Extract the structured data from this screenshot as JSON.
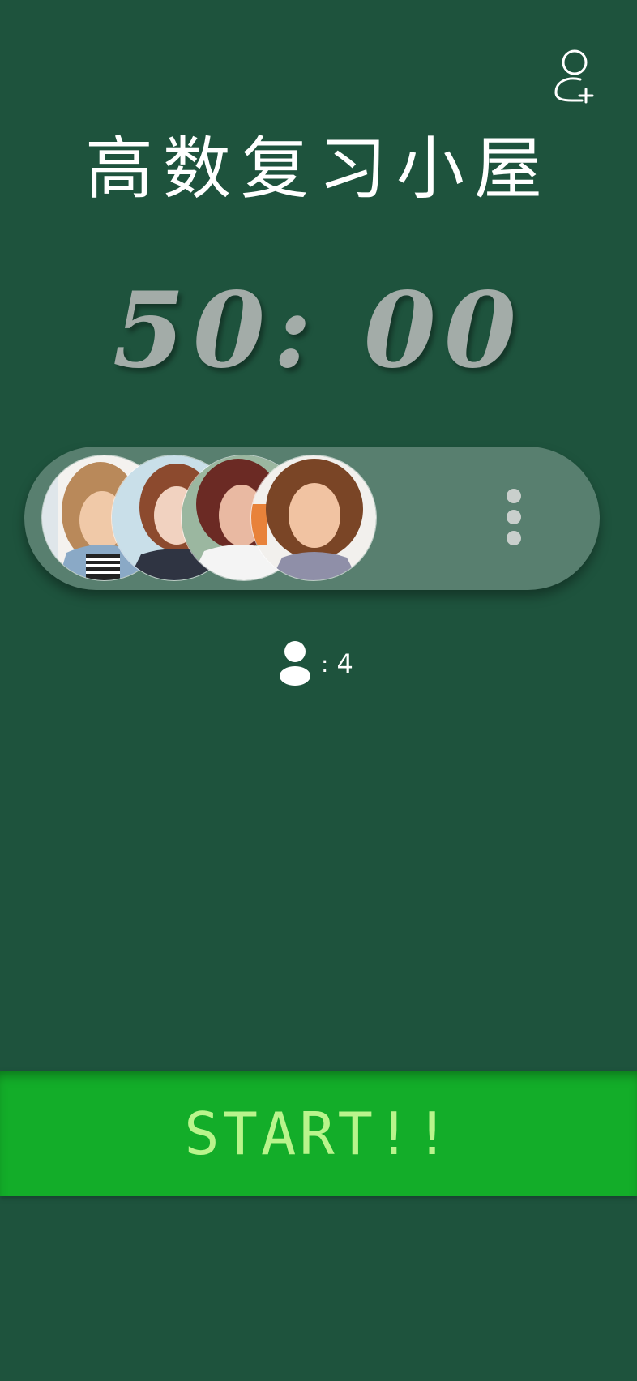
{
  "header": {
    "title": "高数复习小屋",
    "add_member_icon": "add-user-icon"
  },
  "timer": {
    "display": "50: 00"
  },
  "group": {
    "avatars": [
      {
        "icon": "avatar-photo"
      },
      {
        "icon": "avatar-photo"
      },
      {
        "icon": "avatar-photo"
      },
      {
        "icon": "avatar-photo"
      }
    ],
    "more_icon": "more-vertical-icon"
  },
  "members": {
    "icon": "person-icon",
    "separator": ":",
    "count": "4"
  },
  "actions": {
    "start_label": "START!!"
  },
  "colors": {
    "background": "#1e533d",
    "pill": "#587f6f",
    "timer_text": "#a3aca8",
    "start_button": "#13ad29",
    "start_text": "#b9f48c"
  }
}
